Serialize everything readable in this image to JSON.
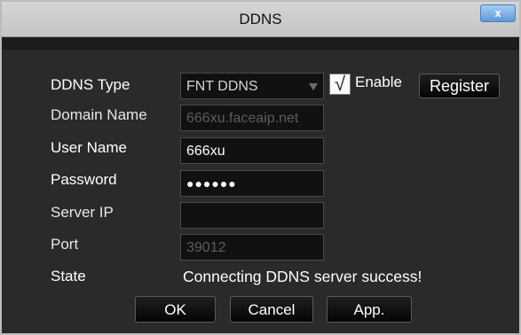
{
  "window": {
    "title": "DDNS",
    "close_label": "x"
  },
  "form": {
    "ddns_type_label": "DDNS Type",
    "ddns_type_value": "FNT DDNS",
    "enable_label": "Enable",
    "enable_checked": true,
    "register_label": "Register",
    "domain_name_label": "Domain Name",
    "domain_name_value": "666xu.faceaip.net",
    "user_name_label": "User Name",
    "user_name_value": "666xu",
    "password_label": "Password",
    "password_value": "●●●●●●",
    "server_ip_label": "Server IP",
    "server_ip_value": "",
    "port_label": "Port",
    "port_value": "39012",
    "state_label": "State",
    "state_value": "Connecting DDNS server success!"
  },
  "footer": {
    "ok_label": "OK",
    "cancel_label": "Cancel",
    "app_label": "App."
  },
  "colors": {
    "background": "#2a2a2a",
    "field_background": "#111111",
    "titlebar": "#cfcfcf",
    "close_button": "#6fa6e0",
    "text": "#ffffff"
  }
}
